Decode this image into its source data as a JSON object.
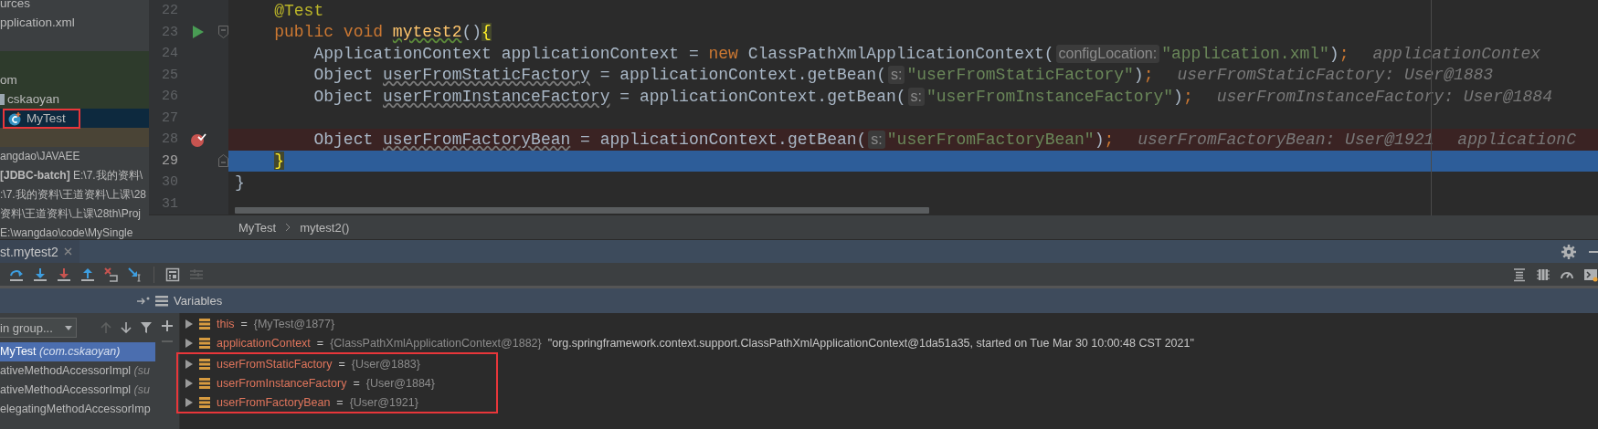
{
  "project_tree": [
    {
      "label": "urces",
      "test_scope": false,
      "selected": false,
      "highlighted": false,
      "children": [
        {
          "label": "pplication.xml",
          "test_scope": false,
          "selected": false,
          "highlighted": false
        }
      ]
    },
    {
      "label": "om",
      "test_scope": true,
      "selected": false,
      "highlighted": false,
      "children": [
        {
          "label": "cskaoyan",
          "kind": "folder",
          "test_scope": true,
          "selected": false,
          "highlighted": false,
          "children": [
            {
              "label": "MyTest",
              "kind": "class",
              "test_scope": true,
              "selected": true,
              "highlighted": true
            }
          ]
        }
      ]
    }
  ],
  "recent_projects": [
    "angdao\\JAVAEE",
    "**[JDBC-batch]**  E:\\7.我的资料\\",
    ":\\7.我的资料\\王道资料\\上课\\28",
    "资料\\王道资料\\上课\\28th\\Proj",
    "E:\\wangdao\\code\\MySingle"
  ],
  "editor": {
    "lines": [
      {
        "number": "22",
        "kind": "member",
        "current": false,
        "breakpoint": false,
        "runnable": false,
        "foldable": false,
        "tokens": [
          {
            "kind": "ann",
            "t": "@Test"
          }
        ]
      },
      {
        "number": "23",
        "kind": "member",
        "current": false,
        "breakpoint": false,
        "runnable": true,
        "foldable": true,
        "tokens": [
          {
            "kind": "kw",
            "t": "public void "
          },
          {
            "kind": "method",
            "t": "mytest2"
          },
          {
            "kind": "plain",
            "t": "()"
          },
          {
            "kind": "brace",
            "t": "{"
          }
        ]
      },
      {
        "number": "24",
        "kind": "body",
        "current": false,
        "breakpoint": false,
        "runnable": false,
        "foldable": false,
        "tokens": [
          {
            "kind": "plain",
            "t": "ApplicationContext applicationContext = "
          },
          {
            "kind": "kw",
            "t": "new"
          },
          {
            "kind": "plain",
            "t": " ClassPathXmlApplicationContext("
          },
          {
            "kind": "hint",
            "t": "configLocation:"
          },
          {
            "kind": "str",
            "t": "\"application.xml\""
          },
          {
            "kind": "plain",
            "t": ")"
          },
          {
            "kind": "kw",
            "t": ";"
          },
          {
            "kind": "inline",
            "t": "applicationContex"
          }
        ]
      },
      {
        "number": "25",
        "kind": "body",
        "current": false,
        "breakpoint": false,
        "runnable": false,
        "foldable": false,
        "tokens": [
          {
            "kind": "plain",
            "t": "Object "
          },
          {
            "kind": "unused",
            "t": "userFromStaticFactory"
          },
          {
            "kind": "plain",
            "t": " = applicationContext.getBean("
          },
          {
            "kind": "hint",
            "t": "s:"
          },
          {
            "kind": "str",
            "t": "\"userFromStaticFactory\""
          },
          {
            "kind": "plain",
            "t": ")"
          },
          {
            "kind": "kw",
            "t": ";"
          },
          {
            "kind": "inline",
            "t": "userFromStaticFactory: User@1883"
          }
        ]
      },
      {
        "number": "26",
        "kind": "body",
        "current": false,
        "breakpoint": false,
        "runnable": false,
        "foldable": false,
        "tokens": [
          {
            "kind": "plain",
            "t": "Object "
          },
          {
            "kind": "unused",
            "t": "userFromInstanceFactory"
          },
          {
            "kind": "plain",
            "t": " = applicationContext.getBean("
          },
          {
            "kind": "hint",
            "t": "s:"
          },
          {
            "kind": "str",
            "t": "\"userFromInstanceFactory\""
          },
          {
            "kind": "plain",
            "t": ")"
          },
          {
            "kind": "kw",
            "t": ";"
          },
          {
            "kind": "inline",
            "t": "userFromInstanceFactory: User@1884"
          }
        ]
      },
      {
        "number": "27",
        "kind": "body",
        "current": false,
        "breakpoint": false,
        "runnable": false,
        "foldable": false
      },
      {
        "number": "28",
        "kind": "body",
        "current": false,
        "breakpoint": true,
        "runnable": false,
        "foldable": false,
        "tokens": [
          {
            "kind": "plain",
            "t": "Object "
          },
          {
            "kind": "unused",
            "t": "userFromFactoryBean"
          },
          {
            "kind": "plain",
            "t": " = applicationContext.getBean("
          },
          {
            "kind": "hint",
            "t": "s:"
          },
          {
            "kind": "str",
            "t": "\"userFromFactoryBean\""
          },
          {
            "kind": "plain",
            "t": ")"
          },
          {
            "kind": "kw",
            "t": ";"
          },
          {
            "kind": "inline",
            "t": "userFromFactoryBean: User@1921"
          },
          {
            "kind": "inline",
            "t": "applicationC"
          }
        ]
      },
      {
        "number": "29",
        "kind": "member",
        "current": true,
        "breakpoint": false,
        "runnable": false,
        "foldable": true,
        "tokens": [
          {
            "kind": "brace",
            "t": "}"
          }
        ]
      },
      {
        "number": "30",
        "kind": "top",
        "current": false,
        "breakpoint": false,
        "runnable": false,
        "foldable": false,
        "tokens": [
          {
            "kind": "plain",
            "t": "}"
          }
        ]
      },
      {
        "number": "31",
        "kind": "top",
        "current": false,
        "breakpoint": false,
        "runnable": false,
        "foldable": false
      }
    ]
  },
  "breadcrumbs": [
    "MyTest",
    "mytest2()"
  ],
  "debug": {
    "tab": {
      "label": "st.mytest2"
    },
    "frames_filter": "in group...",
    "frames": [
      {
        "name": "MyTest",
        "location": "(com.cskaoyan)",
        "selected": true
      },
      {
        "name": "ativeMethodAccessorImpl",
        "location": "(su",
        "selected": false
      },
      {
        "name": "ativeMethodAccessorImpl",
        "location": "(su",
        "selected": false
      },
      {
        "name": "elegatingMethodAccessorImp",
        "selected": false
      }
    ],
    "variables_title": "Variables",
    "variables": [
      {
        "name": "this",
        "sign": "=",
        "ref": "{MyTest@1877}",
        "highlighted": false
      },
      {
        "name": "applicationContext",
        "sign": "=",
        "ref": "{ClassPathXmlApplicationContext@1882}",
        "text": "\"org.springframework.context.support.ClassPathXmlApplicationContext@1da51a35, started on Tue Mar 30 10:00:48 CST 2021\"",
        "highlighted": false
      },
      {
        "name": "userFromStaticFactory",
        "sign": "=",
        "ref": "{User@1883}",
        "highlighted": true
      },
      {
        "name": "userFromInstanceFactory",
        "sign": "=",
        "ref": "{User@1884}",
        "highlighted": true
      },
      {
        "name": "userFromFactoryBean",
        "sign": "=",
        "ref": "{User@1921}",
        "highlighted": true
      }
    ]
  }
}
